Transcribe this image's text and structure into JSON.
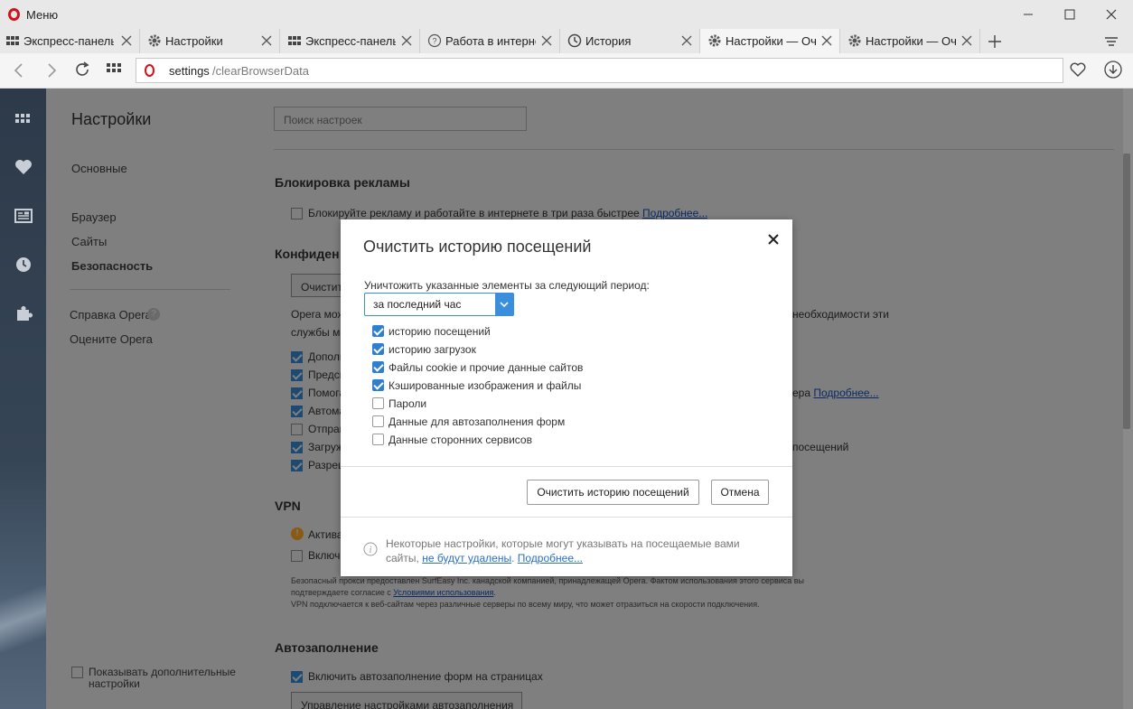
{
  "window": {
    "menu_label": "Меню"
  },
  "tabs": [
    {
      "label": "Экспресс-панель",
      "icon": "grid-icon"
    },
    {
      "label": "Настройки",
      "icon": "gear-icon"
    },
    {
      "label": "Экспресс-панель",
      "icon": "grid-icon"
    },
    {
      "label": "Работа в интернет",
      "icon": "help-icon"
    },
    {
      "label": "История",
      "icon": "clock-icon"
    },
    {
      "label": "Настройки — Очи",
      "icon": "gear-icon",
      "active": true
    },
    {
      "label": "Настройки — Очи",
      "icon": "gear-icon"
    }
  ],
  "address": {
    "host": "settings",
    "path": "/clearBrowserData"
  },
  "settings": {
    "title": "Настройки",
    "nav": {
      "basic": "Основные",
      "browser": "Браузер",
      "sites": "Сайты",
      "security": "Безопасность",
      "help": "Справка Opera",
      "rate": "Оцените Opera"
    },
    "show_more": "Показывать дополнительные настройки",
    "search_placeholder": "Поиск настроек",
    "ads": {
      "heading": "Блокировка рекламы",
      "row": "Блокируйте рекламу и работайте в интернете в три раза быстрее",
      "more": "Подробнее..."
    },
    "privacy": {
      "heading": "Конфиденциальность",
      "button": "Очистить историю посещений...",
      "desc1": "Opera может использовать веб-службы для улучшения работы браузера. При необходимости эти",
      "desc2": "службы можно отключить.",
      "rows": [
        "Дополнительно",
        "Предсказывать",
        "Помогать",
        "Автоматически",
        "Отправлять",
        "Загружать",
        "Разрешать"
      ],
      "row3_suffix": "ера",
      "more": "Подробнее...",
      "row6_suffix": "посещений"
    },
    "vpn": {
      "heading": "VPN",
      "row1": "Активация",
      "row2": "Включить",
      "fine1": "Безопасный прокси предоставлен SurfEasy Inc. канадской компанией, принадлежащей Opera. Фактом использования этого сервиса вы",
      "fine2a": "подтверждаете согласие с ",
      "fine2link": "Условиями использования",
      "fine2b": ".",
      "fine3": "VPN подключается к веб-сайтам через различные серверы по всему миру, что может отразиться на скорости подключения."
    },
    "autofill": {
      "heading": "Автозаполнение",
      "row": "Включить автозаполнение форм на страницах",
      "button": "Управление настройками автозаполнения"
    }
  },
  "dialog": {
    "title": "Очистить историю посещений",
    "period_label": "Уничтожить указанные элементы за следующий период:",
    "period_value": "за последний час",
    "items": [
      {
        "label": "историю посещений",
        "checked": true
      },
      {
        "label": "историю загрузок",
        "checked": true
      },
      {
        "label": "Файлы cookie и прочие данные сайтов",
        "checked": true
      },
      {
        "label": "Кэшированные изображения и файлы",
        "checked": true
      },
      {
        "label": "Пароли",
        "checked": false
      },
      {
        "label": "Данные для автозаполнения форм",
        "checked": false
      },
      {
        "label": "Данные сторонних сервисов",
        "checked": false
      }
    ],
    "clear_button": "Очистить историю посещений",
    "cancel_button": "Отмена",
    "info_text": "Некоторые настройки, которые могут указывать на посещаемые вами сайты,",
    "info_link1": "не будут удалены",
    "info_sep": ".",
    "info_link2": "Подробнее..."
  }
}
